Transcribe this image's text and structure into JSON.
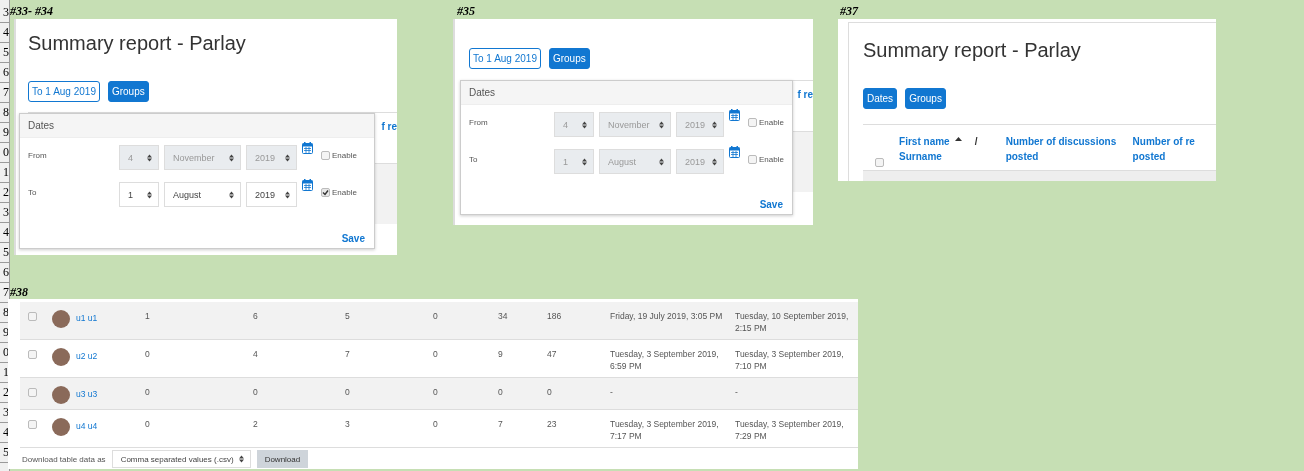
{
  "row_headers": [
    "3",
    "4",
    "5",
    "6",
    "7",
    "8",
    "9",
    "0",
    "1",
    "2",
    "3",
    "4",
    "5",
    "6",
    "7",
    "8",
    "9",
    "0",
    "1",
    "2",
    "3",
    "4",
    "5"
  ],
  "snapshots": [
    {
      "kind": "filter",
      "label": "#33- #34",
      "title": "Summary report - Parlay",
      "buttons": [
        {
          "text": "To 1 Aug 2019",
          "kind": "outline"
        },
        {
          "text": "Groups",
          "kind": "filled"
        }
      ],
      "behind_text": "f re",
      "popup": {
        "heading": "Dates",
        "rows": [
          {
            "label": "From",
            "day": "4",
            "month": "November",
            "year": "2019",
            "enabled": false,
            "checkbox_label": "Enable"
          },
          {
            "label": "To",
            "day": "1",
            "month": "August",
            "year": "2019",
            "enabled": true,
            "checkbox_label": "Enable"
          }
        ],
        "save": "Save"
      }
    },
    {
      "kind": "filter",
      "label": "#35",
      "buttons": [
        {
          "text": "To 1 Aug 2019",
          "kind": "outline"
        },
        {
          "text": "Groups",
          "kind": "filled"
        }
      ],
      "behind_text": "f re",
      "popup": {
        "heading": "Dates",
        "rows": [
          {
            "label": "From",
            "day": "4",
            "month": "November",
            "year": "2019",
            "enabled": false,
            "checkbox_label": "Enable"
          },
          {
            "label": "To",
            "day": "1",
            "month": "August",
            "year": "2019",
            "enabled": false,
            "checkbox_label": "Enable"
          }
        ],
        "save": "Save"
      }
    },
    {
      "kind": "header",
      "label": "#37",
      "title": "Summary report - Parlay",
      "buttons": [
        {
          "text": "Dates",
          "kind": "filled"
        },
        {
          "text": "Groups",
          "kind": "filled"
        }
      ],
      "select_all_checked": false,
      "columns": [
        {
          "text": "First name",
          "sorted": true,
          "separator": "/",
          "subtext": "Surname"
        },
        {
          "text": "Number of discussions posted",
          "sorted": false
        },
        {
          "text": "Number of re",
          "sorted": false,
          "subtext": "posted"
        }
      ]
    },
    {
      "kind": "rows",
      "label": "#38",
      "rows": [
        {
          "checked": false,
          "name": "u1 u1",
          "cells": [
            "1",
            "6",
            "5",
            "0",
            "34",
            "186",
            "Friday, 19 July 2019, 3:05 PM",
            "Tuesday, 10 September 2019, 2:15 PM"
          ]
        },
        {
          "checked": false,
          "name": "u2 u2",
          "cells": [
            "0",
            "4",
            "7",
            "0",
            "9",
            "47",
            "Tuesday, 3 September 2019, 6:59 PM",
            "Tuesday, 3 September 2019, 7:10 PM"
          ]
        },
        {
          "checked": false,
          "name": "u3 u3",
          "cells": [
            "0",
            "0",
            "0",
            "0",
            "0",
            "0",
            "-",
            "-"
          ]
        },
        {
          "checked": false,
          "name": "u4 u4",
          "cells": [
            "0",
            "2",
            "3",
            "0",
            "7",
            "23",
            "Tuesday, 3 September 2019, 7:17 PM",
            "Tuesday, 3 September 2019, 7:29 PM"
          ]
        }
      ],
      "download": {
        "label": "Download table data as",
        "format": "Comma separated values (.csv)",
        "button": "Download"
      }
    }
  ]
}
